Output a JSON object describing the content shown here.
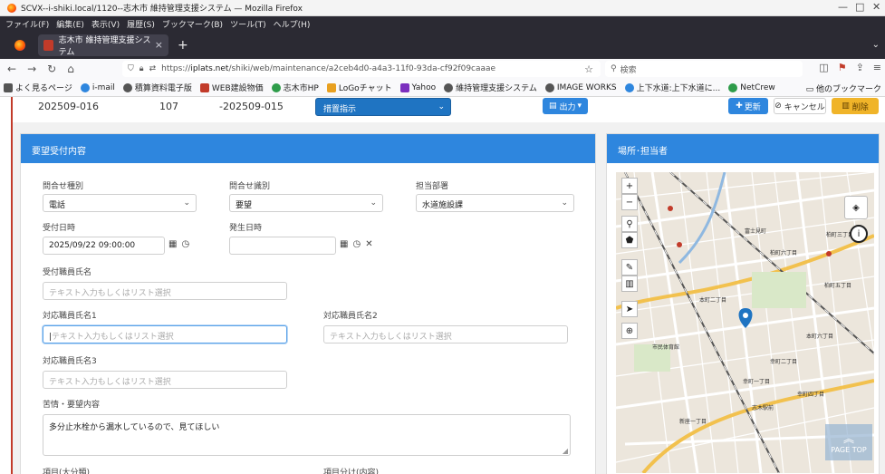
{
  "window": {
    "title": "SCVX--i-shiki.local/1120--志木市 維持管理支援システム — Mozilla Firefox",
    "minimize": "—",
    "maximize": "□",
    "close": "✕"
  },
  "menubar": [
    "ファイル(F)",
    "編集(E)",
    "表示(V)",
    "履歴(S)",
    "ブックマーク(B)",
    "ツール(T)",
    "ヘルプ(H)"
  ],
  "tab": {
    "title": "志木市 維持管理支援システム",
    "close": "×",
    "new_tab": "+"
  },
  "navbar": {
    "url_prefix": "https://",
    "url_host": "iplats.net",
    "url_path": "/shiki/web/maintenance/a2ceb4d0-a4a3-11f0-93da-cf92f09caaae",
    "search_placeholder": "検索"
  },
  "bookmarks": [
    {
      "label": "よく見るページ",
      "color": "#555555"
    },
    {
      "label": "i-mail",
      "color": "#2e86de"
    },
    {
      "label": "積算資料電子版",
      "color": "#555555"
    },
    {
      "label": "WEB建設物価",
      "color": "#c23b2a"
    },
    {
      "label": "志木市HP",
      "color": "#2e9c4a"
    },
    {
      "label": "LoGoチャット",
      "color": "#e8a020"
    },
    {
      "label": "Yahoo",
      "color": "#7b2fbe"
    },
    {
      "label": "維持管理支援システム",
      "color": "#555555"
    },
    {
      "label": "IMAGE WORKS",
      "color": "#555555"
    },
    {
      "label": "上下水道:上下水道に...",
      "color": "#2e86de"
    },
    {
      "label": "NetCrew",
      "color": "#2e9c4a"
    }
  ],
  "bookmarks_other": "他のブックマーク",
  "record": {
    "id": "202509-016",
    "number": "107",
    "parent": "-202509-015",
    "status": "措置指示"
  },
  "actions": {
    "output": "出力",
    "update": "更新",
    "cancel": "キャンセル",
    "delete": "削除"
  },
  "request": {
    "heading": "要望受付内容",
    "inquiry_type_label": "問合せ種別",
    "inquiry_type_value": "電話",
    "inquiry_kind_label": "問合せ識別",
    "inquiry_kind_value": "要望",
    "department_label": "担当部署",
    "department_value": "水道施設課",
    "received_at_label": "受付日時",
    "received_at_value": "2025/09/22 09:00:00",
    "occurred_at_label": "発生日時",
    "occurred_at_value": "",
    "receiver_label": "受付職員氏名",
    "responder1_label": "対応職員氏名1",
    "responder2_label": "対応職員氏名2",
    "responder3_label": "対応職員氏名3",
    "staff_placeholder": "テキスト入力もしくはリスト選択",
    "complaint_label": "苦情・要望内容",
    "complaint_value": "多分止水栓から漏水しているので、見てほしい",
    "category_label": "項目(大分類)",
    "category_detail_label": "項目分け(内容)"
  },
  "map_panel": {
    "heading": "場所･担当者",
    "page_top": "PAGE TOP",
    "labels": [
      "富士見町",
      "柏町三丁目",
      "柏町六丁目",
      "柏町五丁目",
      "市民体育館",
      "本町二丁目",
      "幸町二丁目",
      "幸町四丁目",
      "志木駅前",
      "新座一丁目",
      "幸町一丁目",
      "本町六丁目"
    ]
  }
}
